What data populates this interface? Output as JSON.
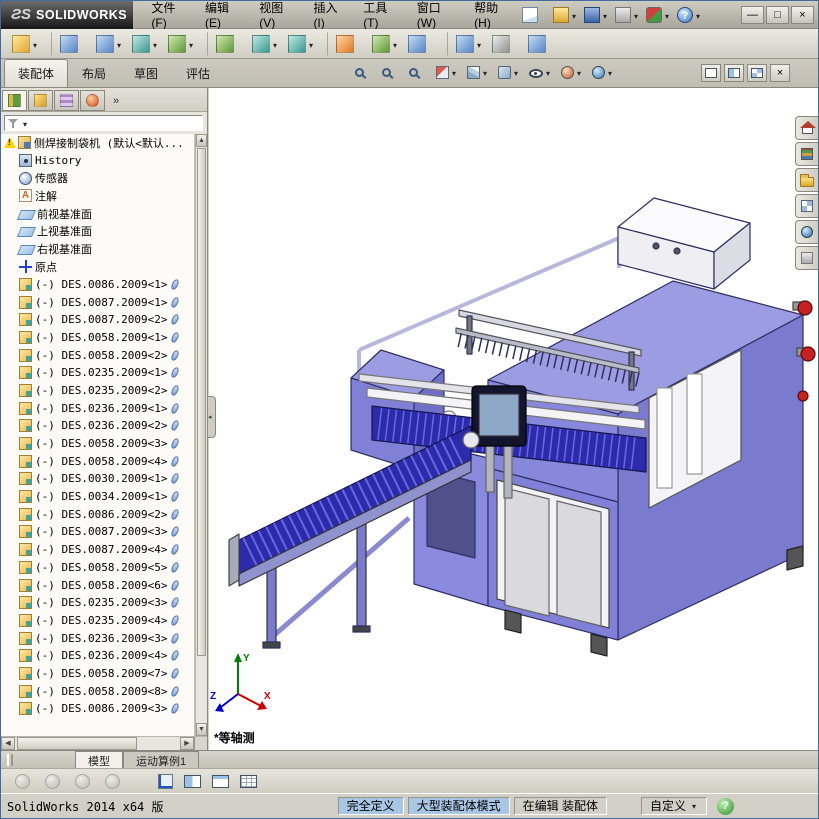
{
  "colors": {
    "machine_purple": "#8080d6",
    "machine_purple_light": "#9c9ce2",
    "conveyor_blue": "#2b2bac",
    "knob_red": "#c42222",
    "chrome": "#d4d1c8",
    "status_highlight": "#a9c6e4"
  },
  "title_bar": {
    "logo_mark": "ƧS",
    "logo_text": "SOLIDWORKS",
    "menus": [
      {
        "label": "文件(F)",
        "name": "menu-file"
      },
      {
        "label": "编辑(E)",
        "name": "menu-edit"
      },
      {
        "label": "视图(V)",
        "name": "menu-view"
      },
      {
        "label": "插入(I)",
        "name": "menu-insert"
      },
      {
        "label": "工具(T)",
        "name": "menu-tools"
      },
      {
        "label": "窗口(W)",
        "name": "menu-window"
      },
      {
        "label": "帮助(H)",
        "name": "menu-help"
      }
    ],
    "quick_icons": [
      {
        "name": "new-document-icon",
        "k": "qi-doc"
      },
      {
        "name": "open-document-icon",
        "k": "qi-open",
        "caret": true
      },
      {
        "name": "save-icon",
        "k": "qi-save",
        "caret": true
      },
      {
        "name": "print-icon",
        "k": "qi-print",
        "caret": true
      },
      {
        "name": "options-icon",
        "k": "qi-opt",
        "caret": true
      },
      {
        "name": "help-icon",
        "k": "qi-help",
        "caret": true
      }
    ],
    "window_buttons": [
      {
        "name": "minimize-button",
        "glyph": "—"
      },
      {
        "name": "maximize-button",
        "glyph": "□"
      },
      {
        "name": "close-button",
        "glyph": "×"
      }
    ]
  },
  "main_toolbar": [
    {
      "name": "insert-components-icon",
      "k": "tb-yellow",
      "caret": true
    },
    {
      "name": "mate-icon",
      "k": "tb-blue"
    },
    {
      "name": "linear-component-pattern-icon",
      "k": "tb-blue",
      "caret": true
    },
    {
      "name": "smart-fasteners-icon",
      "k": "tb-teal",
      "caret": true
    },
    {
      "name": "move-component-icon",
      "k": "tb-green",
      "caret": true
    },
    {
      "name": "show-hidden-components-icon",
      "k": "tb-green"
    },
    {
      "name": "assembly-features-icon",
      "k": "tb-teal",
      "caret": true
    },
    {
      "name": "reference-geometry-icon",
      "k": "tb-teal",
      "caret": true
    },
    {
      "name": "new-motion-study-icon",
      "k": "tb-orange"
    },
    {
      "name": "bill-of-materials-icon",
      "k": "tb-green",
      "caret": true
    },
    {
      "name": "exploded-view-icon",
      "k": "tb-blue"
    },
    {
      "name": "explode-line-sketch-icon",
      "k": "tb-blue",
      "caret": true
    },
    {
      "name": "interference-detection-icon",
      "k": "tb-grey"
    },
    {
      "name": "instant3d-icon",
      "k": "tb-blue"
    }
  ],
  "command_tabs": [
    {
      "label": "装配体",
      "name": "tab-assembly",
      "active": true
    },
    {
      "label": "布局",
      "name": "tab-layout"
    },
    {
      "label": "草图",
      "name": "tab-sketch"
    },
    {
      "label": "评估",
      "name": "tab-evaluate"
    }
  ],
  "hud_toolbar": [
    {
      "name": "zoom-fit-icon",
      "k": "hk-mag"
    },
    {
      "name": "zoom-area-icon",
      "k": "hk-mag"
    },
    {
      "name": "previous-view-icon",
      "k": "hk-mag"
    },
    {
      "name": "section-view-icon",
      "k": "hk-section",
      "caret": true
    },
    {
      "name": "view-orientation-icon",
      "k": "hk-cube",
      "caret": true
    },
    {
      "name": "display-style-icon",
      "k": "hk-style",
      "caret": true
    },
    {
      "name": "hide-show-items-icon",
      "k": "hk-eye",
      "caret": true
    },
    {
      "name": "edit-appearance-icon",
      "k": "hk-ball",
      "caret": true
    },
    {
      "name": "apply-scene-icon",
      "k": "hk-globe",
      "caret": true
    }
  ],
  "tabrow_right": {
    "close_glyph": "×"
  },
  "panel_tabs": [
    {
      "name": "featuremanager-tab-icon",
      "k": "pt-tree",
      "active": true
    },
    {
      "name": "propertymanager-tab-icon",
      "k": "pt-prop"
    },
    {
      "name": "configurationmanager-tab-icon",
      "k": "pt-config"
    },
    {
      "name": "dimxpertmanager-tab-icon",
      "k": "pt-dim"
    }
  ],
  "panel_overflow_glyph": "»",
  "feature_tree": {
    "root": {
      "label": "侧焊接制袋机 (默认<默认...",
      "icon": "ic-assembly"
    },
    "items": [
      {
        "label": "History",
        "icon": "ic-history"
      },
      {
        "label": "传感器",
        "icon": "ic-sensor"
      },
      {
        "label": "注解",
        "icon": "ic-annotation"
      },
      {
        "label": "前视基准面",
        "icon": "ic-plane"
      },
      {
        "label": "上视基准面",
        "icon": "ic-plane"
      },
      {
        "label": "右视基准面",
        "icon": "ic-plane"
      },
      {
        "label": "原点",
        "icon": "ic-origin"
      },
      {
        "label": "(-) DES.0086.2009<1>",
        "icon": "ic-component",
        "trail": true
      },
      {
        "label": "(-) DES.0087.2009<1>",
        "icon": "ic-component",
        "trail": true
      },
      {
        "label": "(-) DES.0087.2009<2>",
        "icon": "ic-component",
        "trail": true
      },
      {
        "label": "(-) DES.0058.2009<1>",
        "icon": "ic-component",
        "trail": true
      },
      {
        "label": "(-) DES.0058.2009<2>",
        "icon": "ic-component",
        "trail": true
      },
      {
        "label": "(-) DES.0235.2009<1>",
        "icon": "ic-component",
        "trail": true
      },
      {
        "label": "(-) DES.0235.2009<2>",
        "icon": "ic-component",
        "trail": true
      },
      {
        "label": "(-) DES.0236.2009<1>",
        "icon": "ic-component",
        "trail": true
      },
      {
        "label": "(-) DES.0236.2009<2>",
        "icon": "ic-component",
        "trail": true
      },
      {
        "label": "(-) DES.0058.2009<3>",
        "icon": "ic-component",
        "trail": true
      },
      {
        "label": "(-) DES.0058.2009<4>",
        "icon": "ic-component",
        "trail": true
      },
      {
        "label": "(-) DES.0030.2009<1>",
        "icon": "ic-component",
        "trail": true
      },
      {
        "label": "(-) DES.0034.2009<1>",
        "icon": "ic-component",
        "trail": true
      },
      {
        "label": "(-) DES.0086.2009<2>",
        "icon": "ic-component",
        "trail": true
      },
      {
        "label": "(-) DES.0087.2009<3>",
        "icon": "ic-component",
        "trail": true
      },
      {
        "label": "(-) DES.0087.2009<4>",
        "icon": "ic-component",
        "trail": true
      },
      {
        "label": "(-) DES.0058.2009<5>",
        "icon": "ic-component",
        "trail": true
      },
      {
        "label": "(-) DES.0058.2009<6>",
        "icon": "ic-component",
        "trail": true
      },
      {
        "label": "(-) DES.0235.2009<3>",
        "icon": "ic-component",
        "trail": true
      },
      {
        "label": "(-) DES.0235.2009<4>",
        "icon": "ic-component",
        "trail": true
      },
      {
        "label": "(-) DES.0236.2009<3>",
        "icon": "ic-component",
        "trail": true
      },
      {
        "label": "(-) DES.0236.2009<4>",
        "icon": "ic-component",
        "trail": true
      },
      {
        "label": "(-) DES.0058.2009<7>",
        "icon": "ic-component",
        "trail": true
      },
      {
        "label": "(-) DES.0058.2009<8>",
        "icon": "ic-component",
        "trail": true
      },
      {
        "label": "(-) DES.0086.2009<3>",
        "icon": "ic-component",
        "trail": true
      }
    ]
  },
  "task_pane": [
    {
      "name": "solidworks-resources-icon",
      "k": "tp-home"
    },
    {
      "name": "design-library-icon",
      "k": "tp-lib"
    },
    {
      "name": "file-explorer-icon",
      "k": "tp-folder"
    },
    {
      "name": "view-palette-icon",
      "k": "tp-palette"
    },
    {
      "name": "appearances-scenes-icon",
      "k": "tp-sphere"
    },
    {
      "name": "custom-properties-icon",
      "k": "tp-props"
    }
  ],
  "viewport": {
    "view_label": "*等轴测",
    "triad": {
      "x": "X",
      "y": "Y",
      "z": "Z"
    }
  },
  "bottom_tabs": [
    {
      "label": "模型",
      "name": "tab-model",
      "active": true
    },
    {
      "label": "运动算例1",
      "name": "tab-motion-study-1"
    }
  ],
  "lower_toolbar_left": [
    {
      "name": "disabled-tool-icon-1",
      "k": "lt-disc"
    },
    {
      "name": "disabled-tool-icon-2",
      "k": "lt-disc"
    },
    {
      "name": "disabled-tool-icon-3",
      "k": "lt-disc"
    },
    {
      "name": "disabled-tool-icon-4",
      "k": "lt-disc"
    }
  ],
  "lower_toolbar_right": [
    {
      "name": "axis-tool-icon",
      "k": "lt-axis"
    },
    {
      "name": "split-window-icon",
      "k": "lt-split"
    },
    {
      "name": "pane-window-icon",
      "k": "lt-pane"
    },
    {
      "name": "grid-table-icon",
      "k": "lt-grid"
    }
  ],
  "status_bar": {
    "product": "SolidWorks 2014 x64 版",
    "define_state": "完全定义",
    "mode": "大型装配体模式",
    "editing": "在编辑 装配体",
    "custom": "自定义",
    "help_glyph": "?"
  }
}
